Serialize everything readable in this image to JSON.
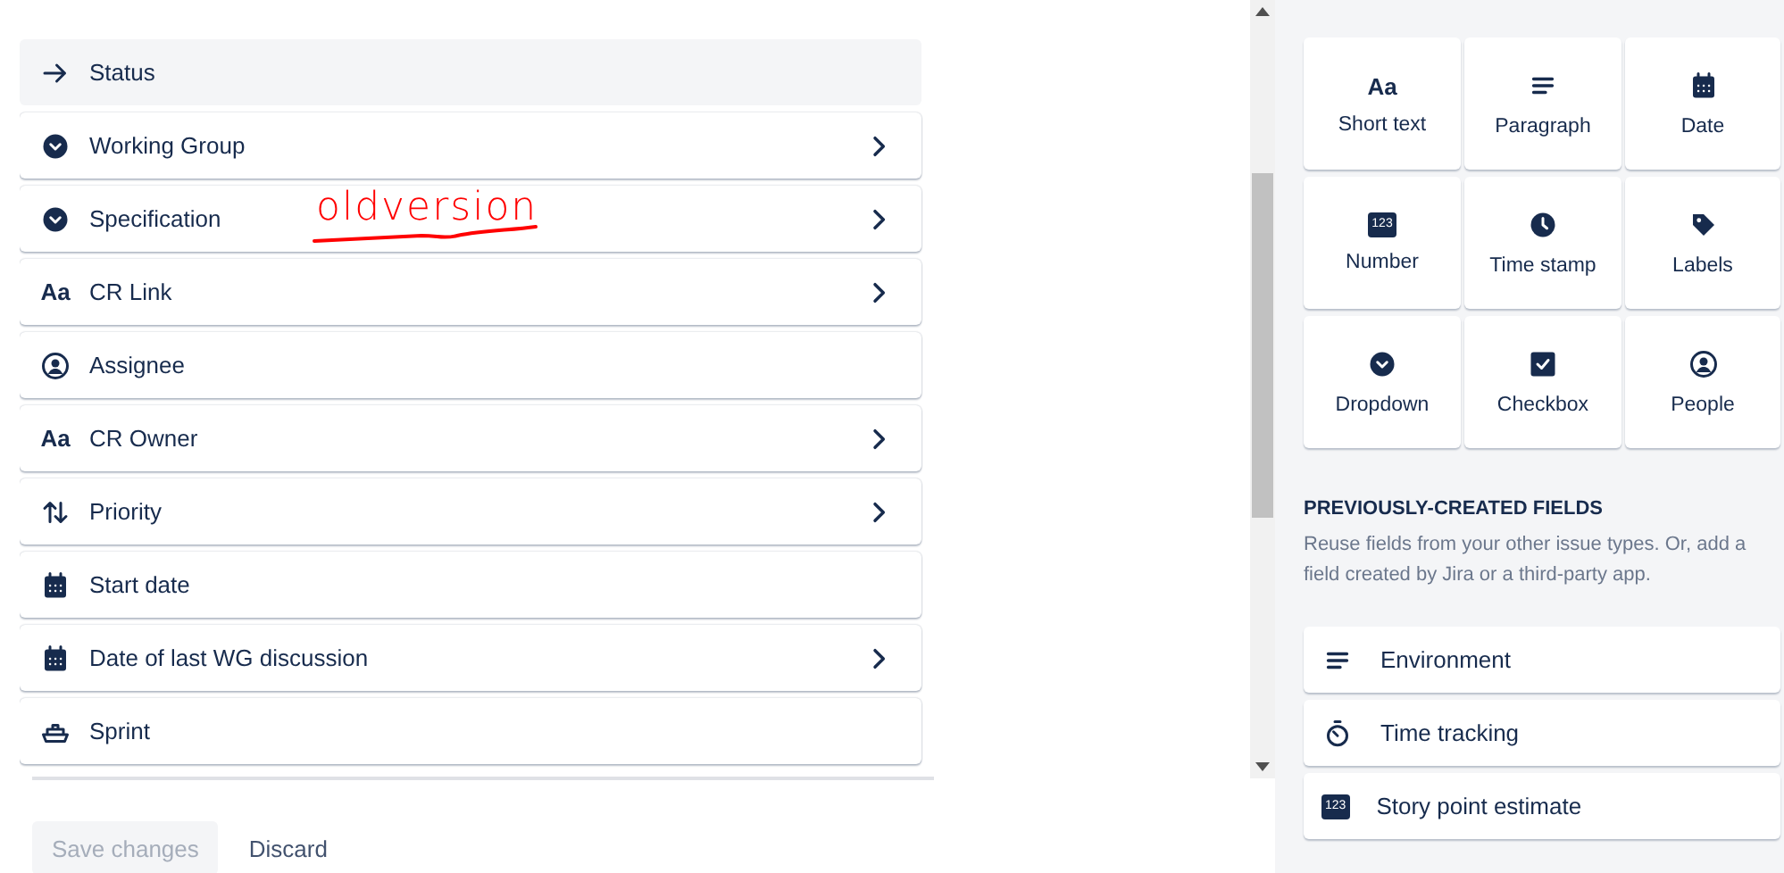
{
  "context_fields": [
    {
      "label": "Status",
      "kind": "arrow",
      "locked": true,
      "has_chevron": false
    },
    {
      "label": "Working Group",
      "kind": "dropdown",
      "locked": false,
      "has_chevron": true
    },
    {
      "label": "Specification",
      "kind": "dropdown",
      "locked": false,
      "has_chevron": true,
      "annotation": "oldversion"
    },
    {
      "label": "CR Link",
      "kind": "text",
      "glyph": "Aa",
      "locked": false,
      "has_chevron": true
    },
    {
      "label": "Assignee",
      "kind": "person",
      "locked": false,
      "has_chevron": false
    },
    {
      "label": "CR Owner",
      "kind": "text",
      "glyph": "Aa",
      "locked": false,
      "has_chevron": true
    },
    {
      "label": "Priority",
      "kind": "priority",
      "locked": false,
      "has_chevron": true
    },
    {
      "label": "Start date",
      "kind": "calendar",
      "locked": false,
      "has_chevron": false
    },
    {
      "label": "Date of last WG discussion",
      "kind": "calendar",
      "locked": false,
      "has_chevron": true
    },
    {
      "label": "Sprint",
      "kind": "sprint",
      "locked": false,
      "has_chevron": false
    }
  ],
  "buttons": [
    {
      "label": "Save changes",
      "disabled": true
    },
    {
      "label": "Discard",
      "disabled": false
    }
  ],
  "palette": [
    {
      "label": "Short text",
      "kind": "text",
      "glyph": "Aa"
    },
    {
      "label": "Paragraph",
      "kind": "paragraph"
    },
    {
      "label": "Date",
      "kind": "calendar"
    },
    {
      "label": "Number",
      "kind": "number",
      "glyph": "123"
    },
    {
      "label": "Time stamp",
      "kind": "clock"
    },
    {
      "label": "Labels",
      "kind": "tag"
    },
    {
      "label": "Dropdown",
      "kind": "dropdown"
    },
    {
      "label": "Checkbox",
      "kind": "checkbox"
    },
    {
      "label": "People",
      "kind": "person"
    }
  ],
  "previously_created": {
    "heading": "PREVIOUSLY-CREATED FIELDS",
    "description": "Reuse fields from your other issue types. Or, add a field created by Jira or a third-party app.",
    "fields": [
      {
        "label": "Environment",
        "kind": "paragraph"
      },
      {
        "label": "Time tracking",
        "kind": "stopwatch"
      },
      {
        "label": "Story point estimate",
        "kind": "number",
        "glyph": "123"
      }
    ]
  }
}
